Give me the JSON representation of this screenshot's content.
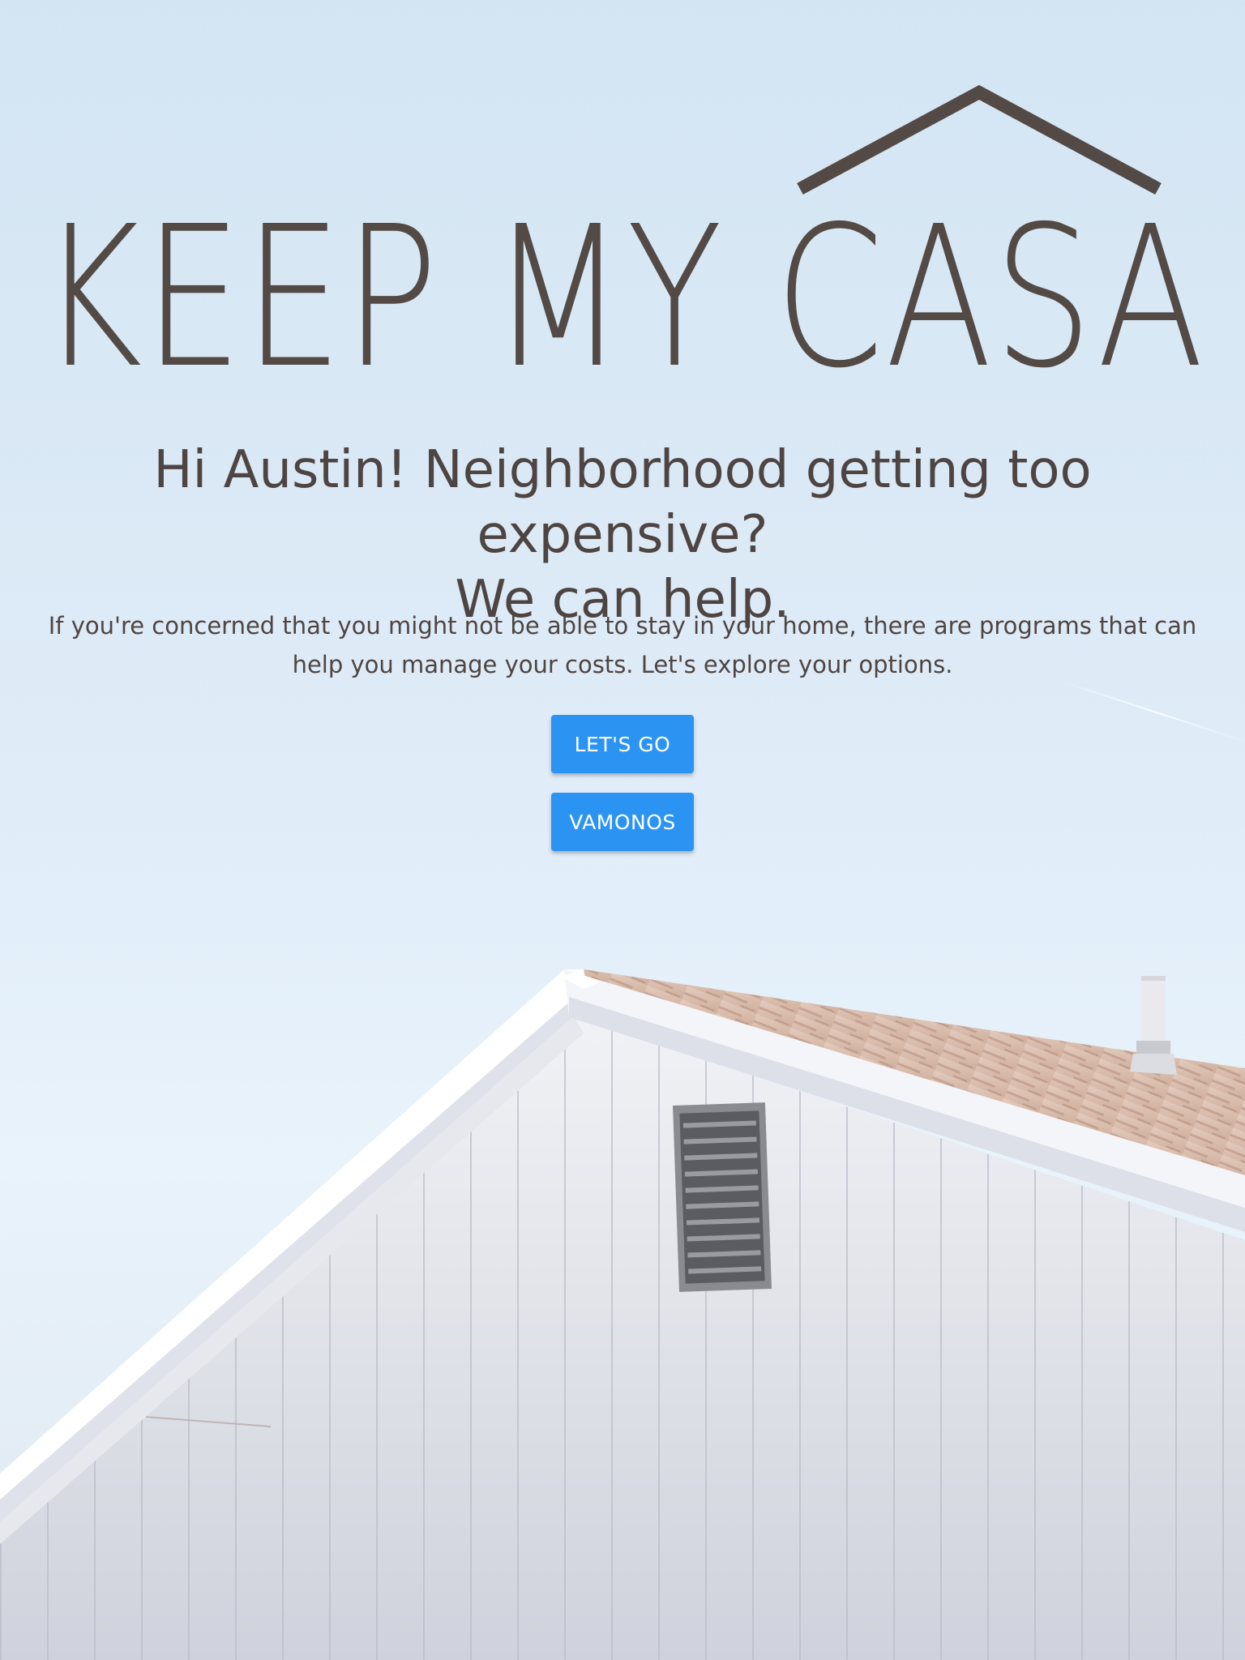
{
  "logo": {
    "text": "KEEP MY CASA"
  },
  "hero": {
    "headline_line1": "Hi Austin! Neighborhood getting too expensive?",
    "headline_line2": "We can help.",
    "description": "If you're concerned that you might not be able to stay in your home, there are programs that can help you manage your costs. Let's explore your options."
  },
  "actions": {
    "primary_label": "LET'S GO",
    "secondary_label": "VAMONOS"
  },
  "colors": {
    "text": "#4e4542",
    "logo": "#544a45",
    "button": "#2b94f2",
    "button_text": "#ffffff"
  },
  "background": {
    "image": "house-gable-roof-photo"
  }
}
